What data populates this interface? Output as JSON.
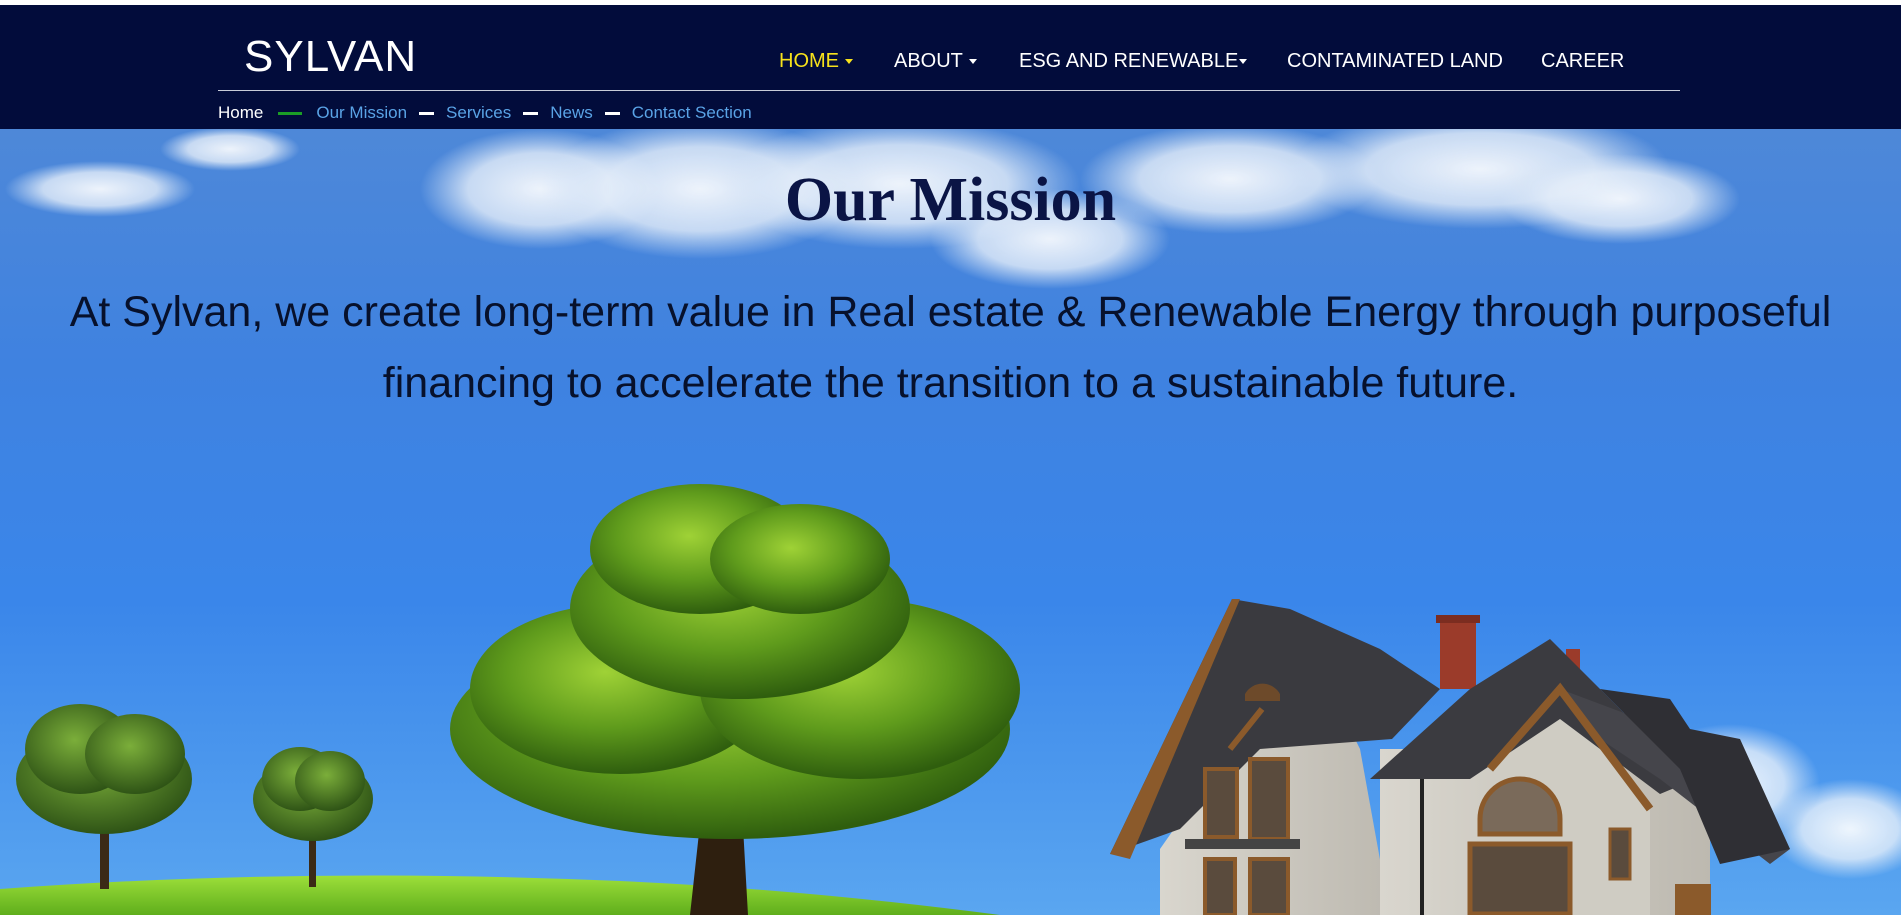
{
  "brand": {
    "name": "SYLVAN"
  },
  "menu": [
    {
      "label": "HOME",
      "active": true,
      "dropdown": true
    },
    {
      "label": "ABOUT",
      "active": false,
      "dropdown": true
    },
    {
      "label": "ESG AND RENEWABLE",
      "active": false,
      "dropdown": true
    },
    {
      "label": "CONTAMINATED LAND",
      "active": false,
      "dropdown": false
    },
    {
      "label": "CAREER",
      "active": false,
      "dropdown": false
    }
  ],
  "subnav": {
    "home": "Home",
    "links": [
      "Our Mission",
      "Services",
      "News",
      "Contact Section"
    ]
  },
  "hero": {
    "title": "Our Mission",
    "text": "At Sylvan, we create long-term value in Real estate & Renewable Energy through purposeful financing to accelerate the transition to a sustainable future."
  },
  "colors": {
    "navbar_bg": "#020c3b",
    "active_menu": "#f7e21b",
    "subnav_link": "#5aa3e6",
    "subnav_green_dash": "#1b9e26",
    "sky": "#3a86ea",
    "title_text": "#0a1445"
  },
  "icons": [
    "caret-down-icon"
  ]
}
